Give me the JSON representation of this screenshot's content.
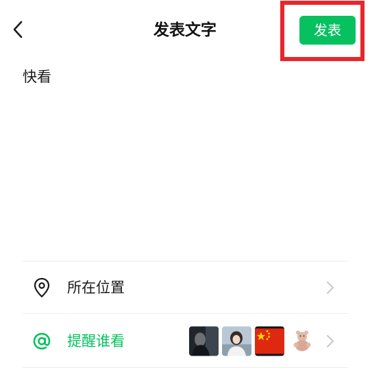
{
  "header": {
    "title": "发表文字",
    "publish_label": "发表"
  },
  "post": {
    "text": "快看"
  },
  "rows": {
    "location_label": "所在位置",
    "mention_label": "提醒谁看"
  },
  "icons": {
    "back": "chevron-left-icon",
    "location": "map-pin-icon",
    "mention": "at-icon",
    "chevron": "chevron-right-icon"
  },
  "colors": {
    "accent": "#07c160",
    "highlight": "#e8262c",
    "flag_red": "#de2910",
    "flag_star": "#ffde00"
  }
}
